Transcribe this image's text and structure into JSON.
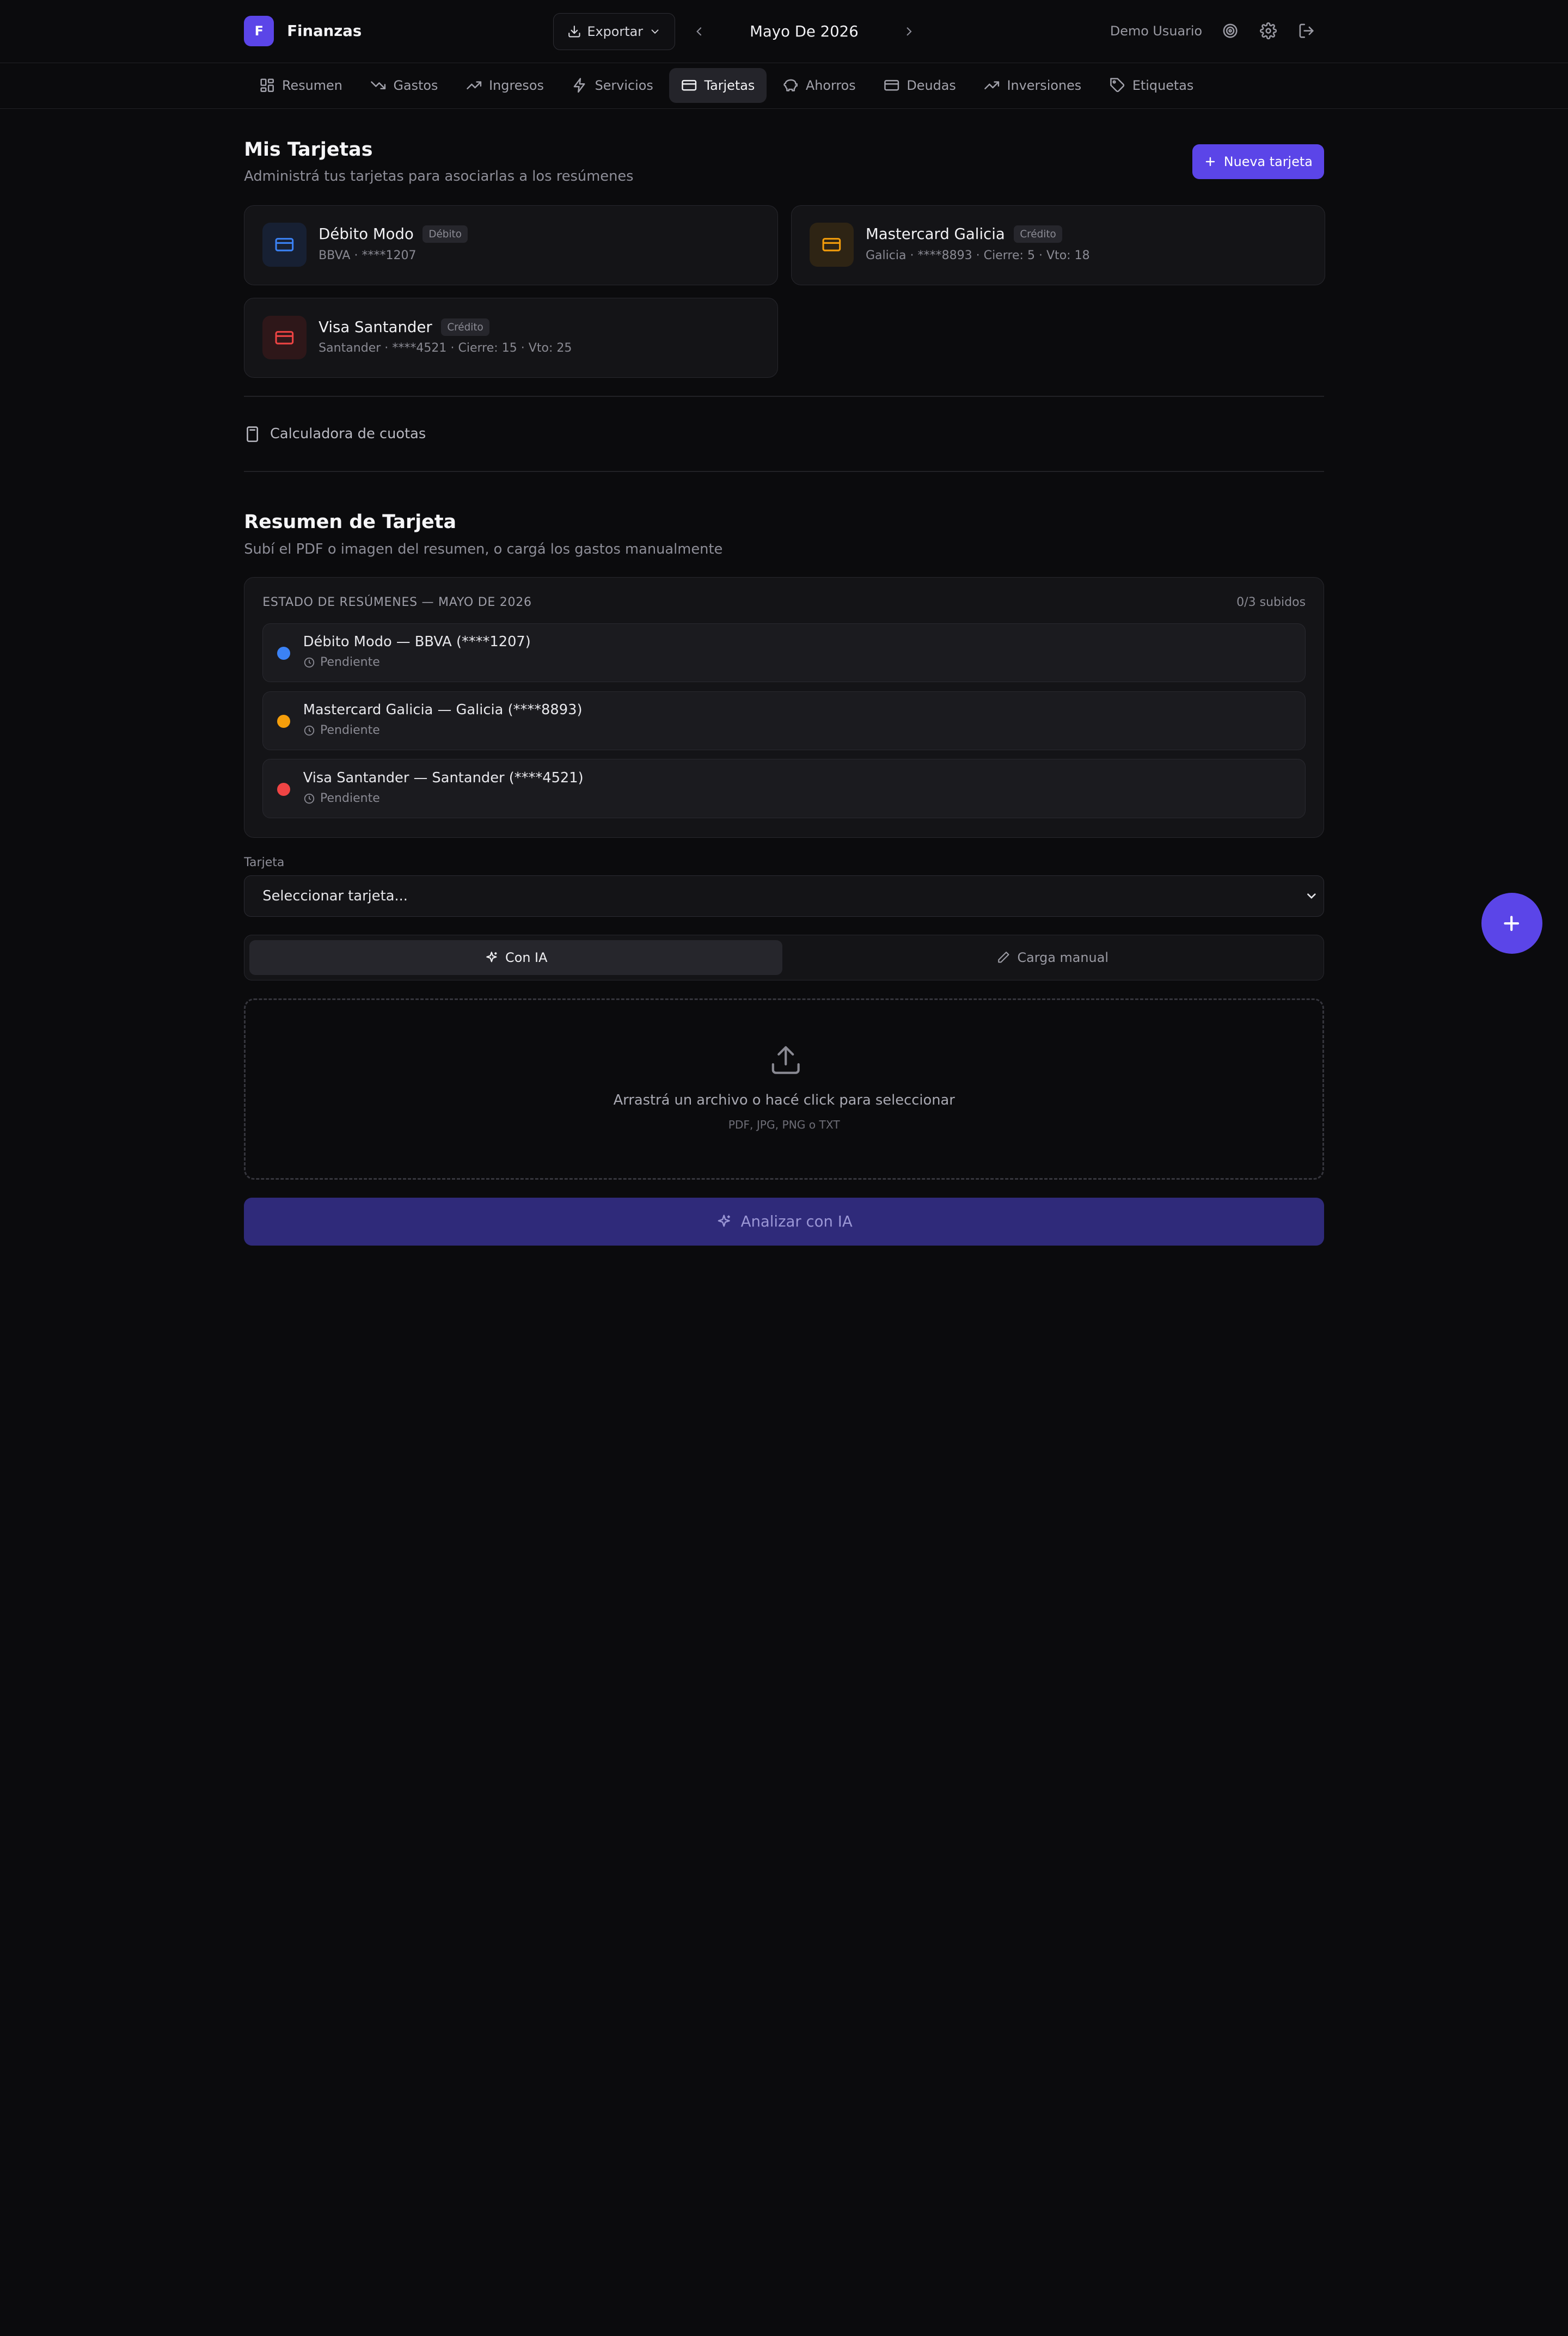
{
  "brand": {
    "logo": "F",
    "name": "Finanzas"
  },
  "header": {
    "export_label": "Exportar",
    "month": "Mayo De 2026",
    "user": "Demo Usuario"
  },
  "tabs": [
    {
      "label": "Resumen",
      "icon": "grid-icon"
    },
    {
      "label": "Gastos",
      "icon": "trending-down-icon"
    },
    {
      "label": "Ingresos",
      "icon": "trending-up-icon"
    },
    {
      "label": "Servicios",
      "icon": "lightning-icon"
    },
    {
      "label": "Tarjetas",
      "icon": "credit-card-icon",
      "active": true
    },
    {
      "label": "Ahorros",
      "icon": "piggy-bank-icon"
    },
    {
      "label": "Deudas",
      "icon": "wallet-icon"
    },
    {
      "label": "Inversiones",
      "icon": "chart-up-icon"
    },
    {
      "label": "Etiquetas",
      "icon": "tag-icon"
    }
  ],
  "cards_section": {
    "title": "Mis Tarjetas",
    "subtitle": "Administrá tus tarjetas para asociarlas a los resúmenes",
    "new_button": "Nueva tarjeta"
  },
  "cards": [
    {
      "name": "Débito Modo",
      "badge": "Débito",
      "meta": "BBVA · ****1207",
      "color": "#3b82f6",
      "bg": "#172033"
    },
    {
      "name": "Mastercard Galicia",
      "badge": "Crédito",
      "meta": "Galicia · ****8893 · Cierre: 5 · Vto: 18",
      "color": "#f59e0b",
      "bg": "#2e2414"
    },
    {
      "name": "Visa Santander",
      "badge": "Crédito",
      "meta": "Santander · ****4521 · Cierre: 15 · Vto: 25",
      "color": "#ef4444",
      "bg": "#2e1719"
    }
  ],
  "calculator": {
    "label": "Calculadora de cuotas"
  },
  "summary_section": {
    "title": "Resumen de Tarjeta",
    "subtitle": "Subí el PDF o imagen del resumen, o cargá los gastos manualmente"
  },
  "status": {
    "heading": "ESTADO DE RESÚMENES — MAYO DE 2026",
    "count": "0/3 subidos",
    "items": [
      {
        "name": "Débito Modo — BBVA (****1207)",
        "state": "Pendiente",
        "color": "#3b82f6"
      },
      {
        "name": "Mastercard Galicia — Galicia (****8893)",
        "state": "Pendiente",
        "color": "#f59e0b"
      },
      {
        "name": "Visa Santander — Santander (****4521)",
        "state": "Pendiente",
        "color": "#ef4444"
      }
    ]
  },
  "form": {
    "card_label": "Tarjeta",
    "card_select": "Seleccionar tarjeta...",
    "mode_ai": "Con IA",
    "mode_manual": "Carga manual"
  },
  "dropzone": {
    "main": "Arrastrá un archivo o hacé click para seleccionar",
    "hint": "PDF, JPG, PNG o TXT"
  },
  "analyze_button": "Analizar con IA",
  "colors": {
    "accent": "#5b45e8",
    "background": "#0b0b0d"
  }
}
